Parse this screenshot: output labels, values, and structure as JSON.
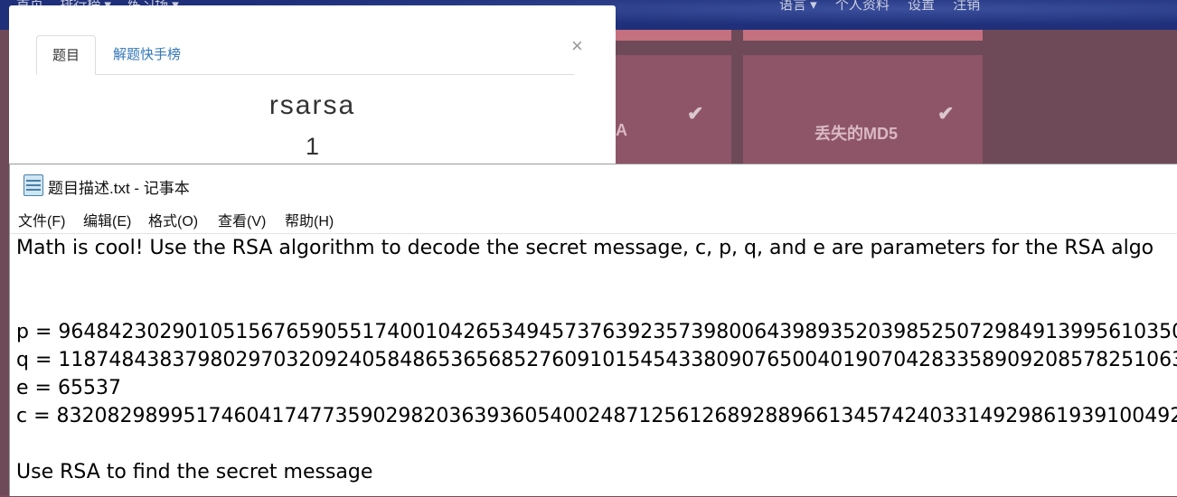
{
  "topnav": {
    "left_items": [
      "首页",
      "排行榜 ▾",
      "练习场 ▾"
    ],
    "right_items": [
      "语言 ▾",
      "个人资料",
      "设置",
      "注销"
    ]
  },
  "cards": [
    {
      "title": "A",
      "check_icon": "check-icon"
    },
    {
      "title": "丢失的MD5",
      "check_icon": "check-icon"
    }
  ],
  "modal": {
    "tabs": [
      {
        "label": "题目",
        "active": true
      },
      {
        "label": "解题快手榜",
        "active": false
      }
    ],
    "close_glyph": "×",
    "challenge_name": "rsarsa",
    "challenge_value": "1"
  },
  "notepad": {
    "title": "题目描述.txt - 记事本",
    "menu": [
      "文件(F)",
      "编辑(E)",
      "格式(O)",
      "查看(V)",
      "帮助(H)"
    ],
    "lines": [
      "Math is cool! Use the RSA algorithm to decode the secret message, c, p, q, and e are parameters for the RSA algo",
      "",
      "",
      "p =  96484230290105156765905517400104265349457376392357398006439893520398525072984913995610350",
      "q =  11874843837980297032092405848653656852760910154543380907650040190704283358909208578251063",
      "e =  65537",
      "c =  83208298995174604174773590298203639360540024871256126892889661345742403314929861939100492",
      "",
      "Use RSA to find the secret message"
    ]
  }
}
